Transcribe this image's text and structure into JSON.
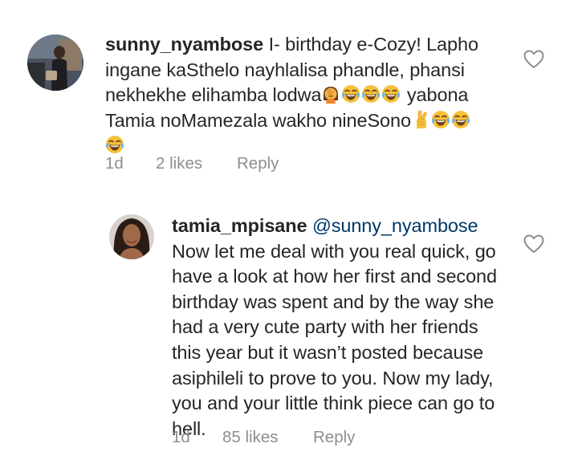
{
  "comments": [
    {
      "username": "sunny_nyambose",
      "text_part1": "I- birthday e-Cozy! Lapho ingane kaSthelo nayhlalisa phandle, phansi nekhekhe elihamba lodwa",
      "text_part2": "yabona Tamia noMamezala wakho nineSono",
      "emojis_after_part1": [
        "woman-facepalming",
        "face-with-tears-of-joy",
        "face-with-tears-of-joy",
        "face-with-tears-of-joy"
      ],
      "emojis_after_part2": [
        "crossed-fingers",
        "face-with-tears-of-joy",
        "face-with-tears-of-joy",
        "face-with-tears-of-joy"
      ],
      "time": "1d",
      "likes": "2 likes",
      "reply_label": "Reply",
      "avatar_icon": "user-photo-avatar",
      "like_icon": "heart-outline-icon"
    },
    {
      "username": "tamia_mpisane",
      "mention": "@sunny_nyambose",
      "text": "Now let me deal with you real quick, go have a look at how her first and second birthday was spent and by the way she had a very cute party with her friends this year but it wasn’t posted because asiphileli to prove to you. Now my lady, you and your little think piece can go to hell.",
      "time": "1d",
      "likes": "85 likes",
      "reply_label": "Reply",
      "avatar_icon": "user-photo-avatar",
      "like_icon": "heart-outline-icon"
    }
  ],
  "colors": {
    "text": "#262626",
    "secondary": "#8e8e8e",
    "mention": "#00376b",
    "background": "#ffffff"
  }
}
